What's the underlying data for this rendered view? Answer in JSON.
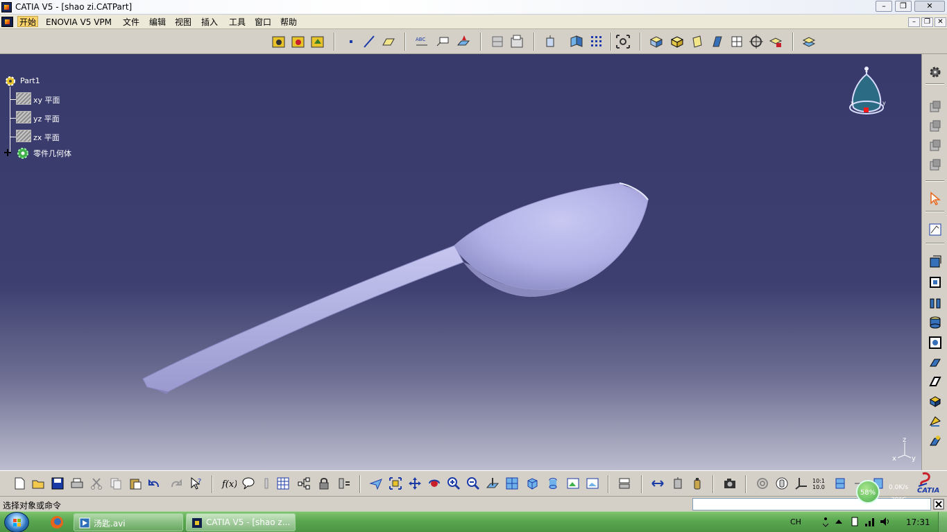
{
  "window": {
    "title": "CATIA V5 - [shao zi.CATPart]",
    "controls": {
      "minimize": "–",
      "maximize": "❐",
      "close": "✕"
    }
  },
  "menubar": {
    "items": [
      {
        "label": "开始",
        "active": true
      },
      {
        "label": "ENOVIA V5 VPM"
      },
      {
        "label": "文件"
      },
      {
        "label": "编辑"
      },
      {
        "label": "视图"
      },
      {
        "label": "插入"
      },
      {
        "label": "工具"
      },
      {
        "label": "窗口"
      },
      {
        "label": "帮助"
      }
    ],
    "mdi_controls": {
      "minimize": "–",
      "restore": "❐",
      "close": "✕"
    }
  },
  "tree": {
    "root": "Part1",
    "children": [
      {
        "label": "xy 平面",
        "icon": "plane-icon"
      },
      {
        "label": "yz 平面",
        "icon": "plane-icon"
      },
      {
        "label": "zx 平面",
        "icon": "plane-icon"
      },
      {
        "label": "零件几何体",
        "icon": "body-gear-icon"
      }
    ]
  },
  "compass": {
    "labels": {
      "z": "z",
      "x": "x",
      "y": "y"
    }
  },
  "axis_triad": {
    "z": "z",
    "x": "x",
    "y": "y"
  },
  "brand": {
    "logo_text": "CATIA"
  },
  "statusbar": {
    "prompt": "选择对象或命令",
    "net_speed": "0.0K/s",
    "temperature": "29°C",
    "cpu_badge": "58%"
  },
  "taskbar": {
    "items": [
      {
        "label": "汤匙.avi"
      },
      {
        "label": "CATIA V5 - [shao z..."
      }
    ],
    "tray_lang": "CH",
    "clock": "17:31"
  },
  "colors": {
    "viewport_top": "#383a6c",
    "viewport_bottom": "#bdbdcf",
    "model": "#b0b0e6",
    "menu_active": "#ffd46b",
    "taskbar": "#5aa650"
  }
}
